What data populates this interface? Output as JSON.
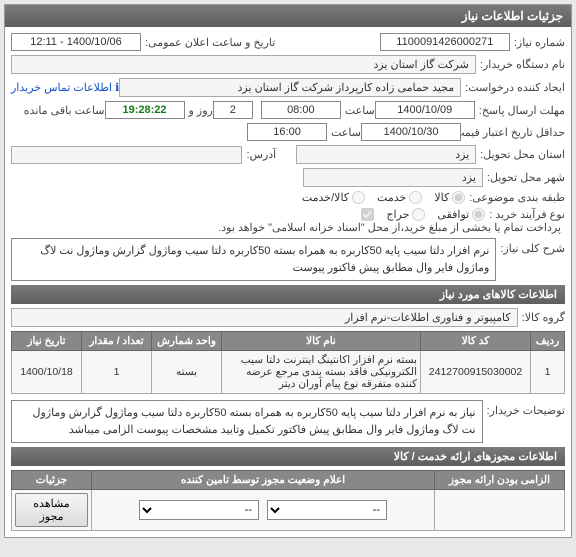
{
  "panel_title": "جزئیات اطلاعات نیاز",
  "labels": {
    "need_number": "شماره نیاز:",
    "buyer_org": "نام دستگاه خریدار:",
    "requester": "ایجاد کننده درخواست:",
    "send_deadline": "مهلت ارسال پاسخ:",
    "validity_period": "حداقل تاریخ اعتبار قیمت تا تاریخ:",
    "deadline_hour": "ساعت",
    "days_and": "روز و",
    "time_remaining": "ساعت باقی مانده",
    "hour": "ساعت",
    "request_city": "استان محل تحویل:",
    "delivery_city": "شهر محل تحویل:",
    "address": "آدرس:",
    "category": "طبقه بندی موضوعی:",
    "purchase_process": "نوع فرآیند خرید :",
    "general_desc": "شرح کلی نیاز:",
    "goods_group": "گروه کالا:",
    "buyer_notes": "توضیحات خریدار:",
    "public_announce": "تاریخ و ساعت اعلان عمومی:",
    "contact_info": "اطلاعات تماس خریدار",
    "payment_note": "پرداخت تمام یا بخشی از مبلغ خرید،از محل \"اسناد خزانه اسلامی\" خواهد بود.",
    "required_license": "الزامی بودن ارائه مجوز",
    "license_status_title": "اعلام وضعیت مجوز توسط تامین کننده",
    "view_license_btn": "مشاهده مجوز",
    "select_placeholder": "--"
  },
  "values": {
    "need_number": "1100091426000271",
    "buyer_org": "شرکت گاز استان یزد",
    "requester": "مجید حمامی زاده کارپرداز شرکت گاز استان یزد",
    "public_announce": "1400/10/06 - 12:11",
    "send_deadline_date": "1400/10/09",
    "send_deadline_time": "08:00",
    "days_remaining": "2",
    "time_remaining": "19:28:22",
    "validity_date": "1400/10/30",
    "validity_time": "16:00",
    "request_city": "یزد",
    "delivery_city": "یزد",
    "address_value": "",
    "general_desc": "نرم افزار دلتا سیب پایه 50کاربره به همراه بسته 50کاربره دلتا سیب وماژول گزارش وماژول نت لاگ وماژول فایر وال مطابق پیش فاکتور پیوست",
    "goods_group": "کامپیوتر و فناوری اطلاعات-نرم افزار",
    "buyer_notes": "نیاز به نرم افزار دلتا سیب پایه 50کاربره به همراه بسته 50کاربره دلتا سیب وماژول گزارش وماژول نت لاگ وماژول فایر وال مطابق پیش فاکتور تکمیل وتایید مشخصات پیوست الزامی میباشد"
  },
  "category_options": {
    "goods": "کالا",
    "service": "خدمت",
    "goods_service": "کالا/خدمت"
  },
  "process_options": {
    "agreement": "توافقی",
    "auction": "حراج"
  },
  "section_titles": {
    "goods_info": "اطلاعات کالاهای مورد نیاز",
    "service_licenses": "اطلاعات مجوزهای ارائه خدمت / کالا",
    "details": "جزئیات"
  },
  "table": {
    "headers": {
      "row": "ردیف",
      "code": "کد کالا",
      "name": "نام کالا",
      "unit": "واحد شمارش",
      "qty": "تعداد / مقدار",
      "date": "تاریخ نیاز"
    },
    "rows": [
      {
        "row": "1",
        "code": "2412700915030002",
        "name": "بسته نرم افزار اکانتینگ اینترنت دلتا سیب الکترونیکی فاقد بسته بندی مرجع عرضه کننده متفرقه نوع پیام آوران دیتر",
        "unit": "بسته",
        "qty": "1",
        "date": "1400/10/18"
      }
    ]
  }
}
